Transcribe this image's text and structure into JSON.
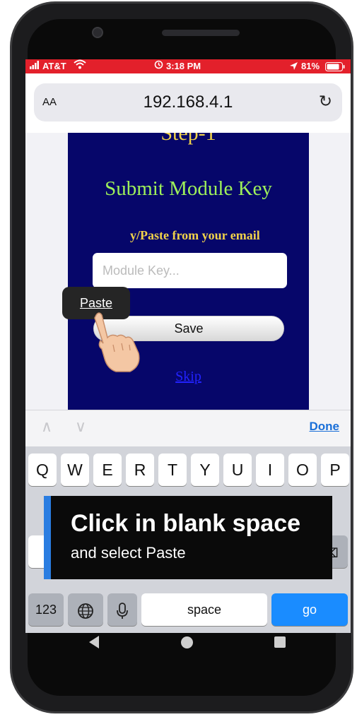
{
  "status_bar": {
    "carrier": "AT&T",
    "time": "3:18 PM",
    "battery": "81%",
    "icons": [
      "signal-icon",
      "wifi-icon",
      "alarm-icon",
      "location-arrow-icon",
      "battery-icon"
    ]
  },
  "browser": {
    "text_size_label": "AA",
    "url": "192.168.4.1",
    "reload_icon": "reload-icon"
  },
  "page": {
    "step_title": "Step-1",
    "heading": "Submit Module Key",
    "instruction": "y/Paste from your email",
    "key_placeholder": "Module Key...",
    "save_label": "Save",
    "skip_label": "Skip"
  },
  "context_menu": {
    "paste_label": "Paste"
  },
  "keyboard_accessory": {
    "done_label": "Done"
  },
  "keyboard": {
    "row1": [
      "Q",
      "W",
      "E",
      "R",
      "T",
      "Y",
      "U",
      "I",
      "O",
      "P"
    ],
    "numbers_label": "123",
    "space_label": "space",
    "go_label": "go",
    "go_color": "#1a8cff"
  },
  "overlay": {
    "title": "Click in blank space",
    "subtitle": "and select Paste",
    "accent_color": "#2a7de1"
  }
}
